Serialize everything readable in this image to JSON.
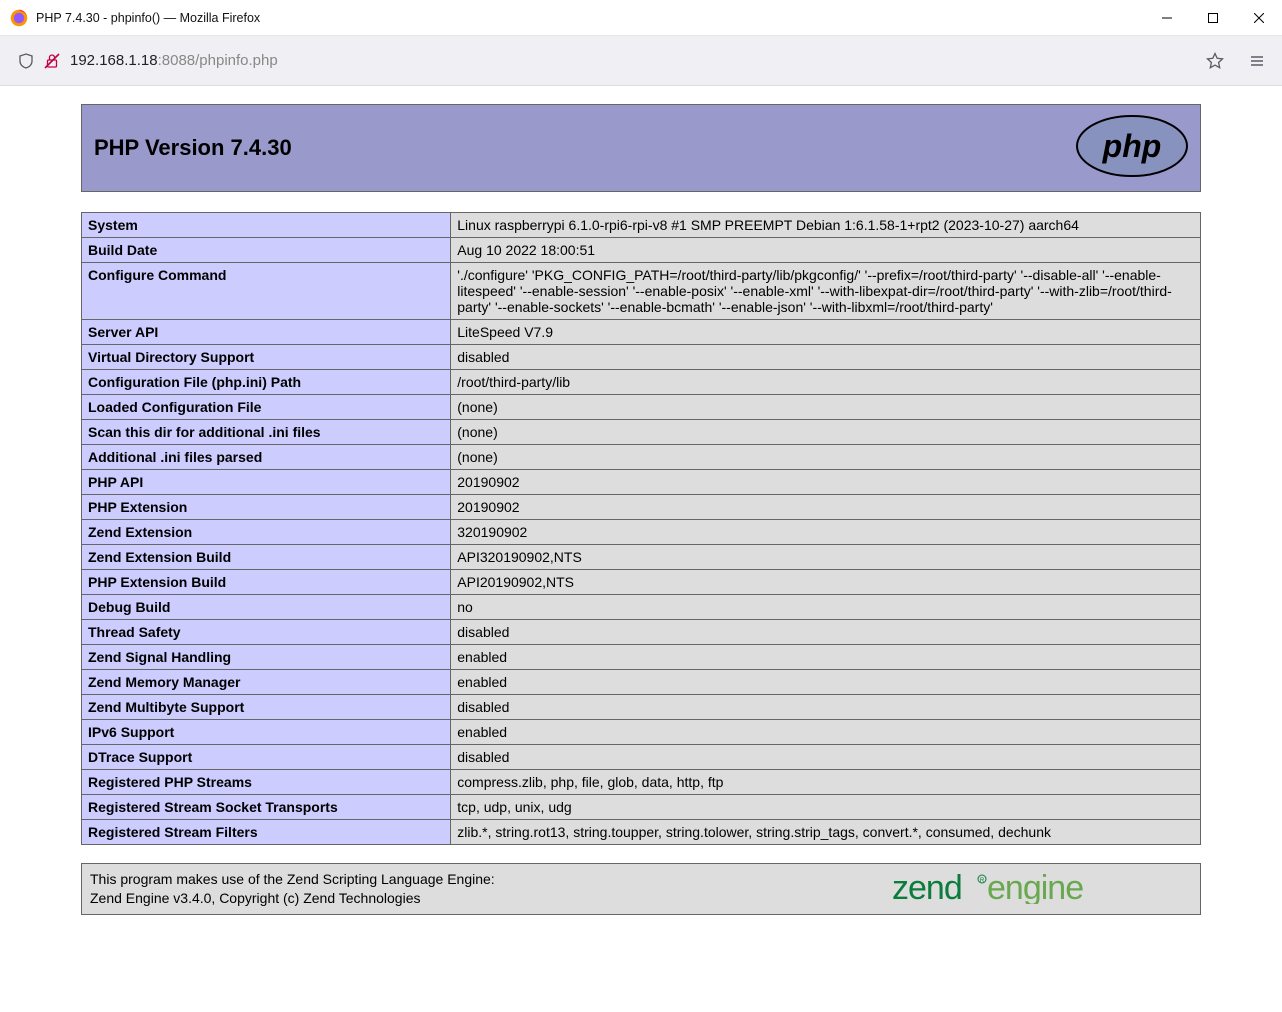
{
  "window": {
    "title": "PHP 7.4.30 - phpinfo() — Mozilla Firefox"
  },
  "addressbar": {
    "host": "192.168.1.18",
    "port_path": ":8088/phpinfo.php"
  },
  "header": {
    "title": "PHP Version 7.4.30"
  },
  "rows": [
    {
      "label": "System",
      "value": "Linux raspberrypi 6.1.0-rpi6-rpi-v8 #1 SMP PREEMPT Debian 1:6.1.58-1+rpt2 (2023-10-27) aarch64"
    },
    {
      "label": "Build Date",
      "value": "Aug 10 2022 18:00:51"
    },
    {
      "label": "Configure Command",
      "value": "'./configure' 'PKG_CONFIG_PATH=/root/third-party/lib/pkgconfig/' '--prefix=/root/third-party' '--disable-all' '--enable-litespeed' '--enable-session' '--enable-posix' '--enable-xml' '--with-libexpat-dir=/root/third-party' '--with-zlib=/root/third-party' '--enable-sockets' '--enable-bcmath' '--enable-json' '--with-libxml=/root/third-party'"
    },
    {
      "label": "Server API",
      "value": "LiteSpeed V7.9"
    },
    {
      "label": "Virtual Directory Support",
      "value": "disabled"
    },
    {
      "label": "Configuration File (php.ini) Path",
      "value": "/root/third-party/lib"
    },
    {
      "label": "Loaded Configuration File",
      "value": "(none)"
    },
    {
      "label": "Scan this dir for additional .ini files",
      "value": "(none)"
    },
    {
      "label": "Additional .ini files parsed",
      "value": "(none)"
    },
    {
      "label": "PHP API",
      "value": "20190902"
    },
    {
      "label": "PHP Extension",
      "value": "20190902"
    },
    {
      "label": "Zend Extension",
      "value": "320190902"
    },
    {
      "label": "Zend Extension Build",
      "value": "API320190902,NTS"
    },
    {
      "label": "PHP Extension Build",
      "value": "API20190902,NTS"
    },
    {
      "label": "Debug Build",
      "value": "no"
    },
    {
      "label": "Thread Safety",
      "value": "disabled"
    },
    {
      "label": "Zend Signal Handling",
      "value": "enabled"
    },
    {
      "label": "Zend Memory Manager",
      "value": "enabled"
    },
    {
      "label": "Zend Multibyte Support",
      "value": "disabled"
    },
    {
      "label": "IPv6 Support",
      "value": "enabled"
    },
    {
      "label": "DTrace Support",
      "value": "disabled"
    },
    {
      "label": "Registered PHP Streams",
      "value": "compress.zlib, php, file, glob, data, http, ftp"
    },
    {
      "label": "Registered Stream Socket Transports",
      "value": "tcp, udp, unix, udg"
    },
    {
      "label": "Registered Stream Filters",
      "value": "zlib.*, string.rot13, string.toupper, string.tolower, string.strip_tags, convert.*, consumed, dechunk"
    }
  ],
  "footer": {
    "line1": "This program makes use of the Zend Scripting Language Engine:",
    "line2": "Zend Engine v3.4.0, Copyright (c) Zend Technologies"
  }
}
